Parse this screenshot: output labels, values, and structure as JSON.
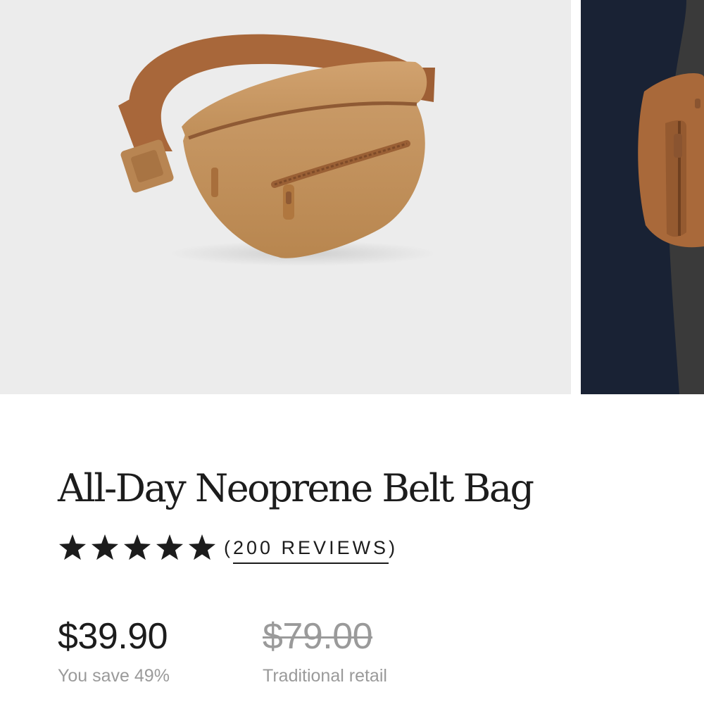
{
  "gallery": {
    "images": [
      {
        "name": "product-image-front",
        "alt": ""
      },
      {
        "name": "product-image-worn",
        "alt": ""
      }
    ]
  },
  "product": {
    "title": "All-Day Neoprene Belt Bag",
    "rating": {
      "stars": 5,
      "open_paren": "(",
      "count_label": "200 REVIEWS",
      "close_paren": ")"
    },
    "price": {
      "current": "$39.90",
      "savings": "You save 49%",
      "retail": "$79.00",
      "retail_label": "Traditional retail"
    }
  },
  "colors": {
    "text": "#1c1c1c",
    "muted": "#9a9a9a",
    "image_bg": "#ececec",
    "image_bg_dark": "#192234",
    "bag_color": "#c4925e"
  }
}
